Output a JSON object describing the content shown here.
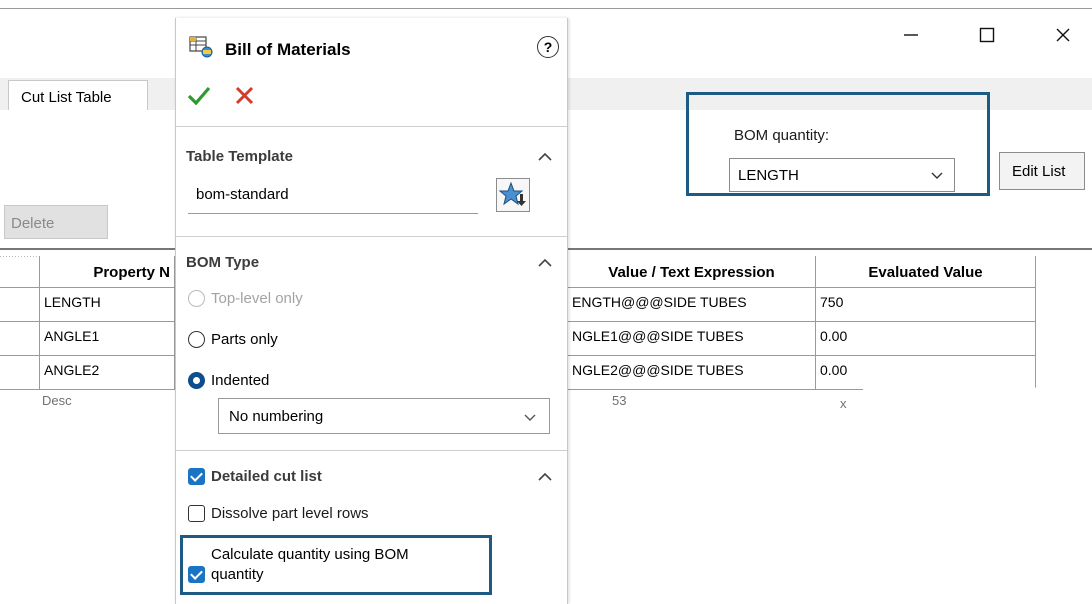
{
  "window": {
    "minimize_glyph": "—",
    "maximize_glyph": "☐",
    "close_glyph": "✕"
  },
  "background_dialog": {
    "tab_label": "Cut List Table",
    "delete_label": "Delete",
    "bom_quantity_label": "BOM quantity:",
    "bom_quantity_value": "LENGTH",
    "edit_list_label": "Edit List",
    "table": {
      "headers": [
        "Property N",
        "Value / Text Expression",
        "Evaluated Value"
      ],
      "rows": [
        {
          "property": "LENGTH",
          "expression": "ENGTH@@@SIDE TUBES",
          "value": "750"
        },
        {
          "property": "ANGLE1",
          "expression": "NGLE1@@@SIDE TUBES",
          "value": "0.00"
        },
        {
          "property": "ANGLE2",
          "expression": "NGLE2@@@SIDE TUBES",
          "value": "0.00"
        }
      ],
      "partial_row": {
        "property": "Desc",
        "expression": "53",
        "value": "x"
      }
    },
    "accent_color": "#1d5b85"
  },
  "panel": {
    "title": "Bill of Materials",
    "help_glyph": "?",
    "ok_color": "#2e9a2e",
    "cancel_color": "#d63a2a",
    "table_template": {
      "title": "Table Template",
      "value": "bom-standard"
    },
    "bom_type": {
      "title": "BOM Type",
      "options": [
        {
          "label": "Top-level only",
          "state": "disabled"
        },
        {
          "label": "Parts only",
          "state": "off"
        },
        {
          "label": "Indented",
          "state": "on"
        }
      ],
      "numbering_value": "No numbering"
    },
    "detailed_cut_list": {
      "title": "Detailed cut list",
      "checked": true,
      "dissolve_label": "Dissolve part level rows",
      "dissolve_checked": false,
      "calc_label_line1": "Calculate quantity using BOM",
      "calc_label_line2": "quantity",
      "calc_checked": true
    }
  }
}
